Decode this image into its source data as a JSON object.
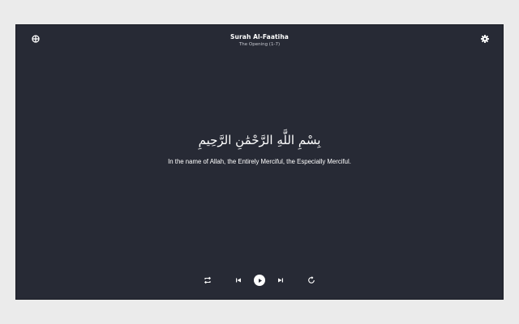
{
  "header": {
    "title": "Surah Al-Faatiha",
    "subtitle": "The Opening (1-7)"
  },
  "verse": {
    "arabic": "بِسْمِ اللَّهِ الرَّحْمَٰنِ الرَّحِيمِ",
    "translation": "In the name of Allah, the Entirely Merciful, the Especially Merciful."
  },
  "icons": {
    "top_left": "crosshair-icon",
    "top_right": "gear-icon",
    "repeat": "repeat-icon",
    "previous": "skip-previous-icon",
    "play": "play-icon",
    "next": "skip-next-icon",
    "replay": "replay-icon"
  },
  "colors": {
    "background": "#272a35",
    "text": "#ffffff",
    "page": "#ebebeb"
  }
}
